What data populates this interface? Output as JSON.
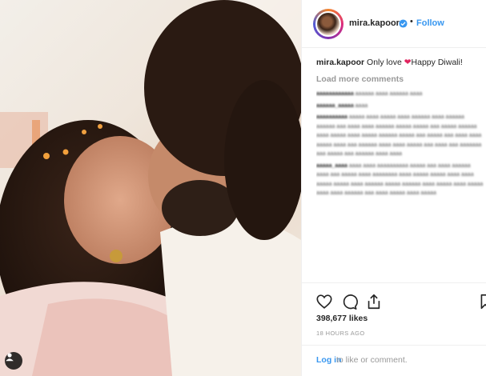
{
  "post": {
    "username": "mira.kapoor",
    "follow_label": "Follow",
    "separator": "•",
    "caption_user": "mira.kapoor",
    "caption_text": "Only love",
    "caption_emoji": "❤",
    "caption_tail": "Happy Diwali!",
    "load_more": "Load more comments",
    "likes": "398,677 likes",
    "time": "18 HOURS AGO",
    "login_label": "Log in",
    "login_rest": "to like or comment."
  },
  "colors": {
    "link": "#3897f0",
    "muted": "#999999",
    "text": "#262626",
    "heart": "#e0245e"
  },
  "icons": [
    "verified-badge-icon",
    "heart-icon",
    "comment-icon",
    "share-icon",
    "bookmark-icon",
    "user-tag-icon"
  ]
}
